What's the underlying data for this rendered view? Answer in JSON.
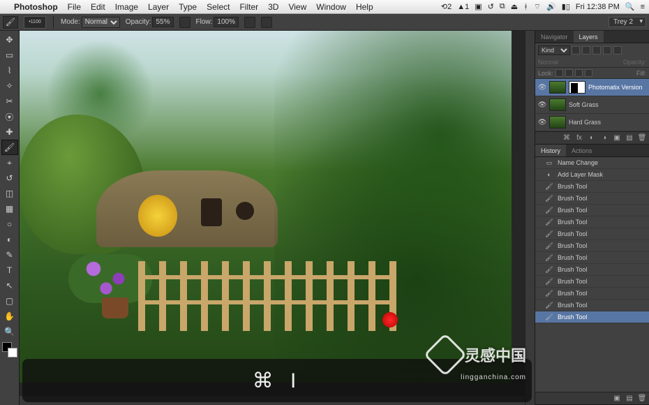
{
  "menubar": {
    "app": "Photoshop",
    "items": [
      "File",
      "Edit",
      "Image",
      "Layer",
      "Type",
      "Select",
      "Filter",
      "3D",
      "View",
      "Window",
      "Help"
    ],
    "clock": "Fri 12:38 PM"
  },
  "options": {
    "brush_size": "1100",
    "mode_label": "Mode:",
    "mode_value": "Normal",
    "opacity_label": "Opacity:",
    "opacity_value": "55%",
    "flow_label": "Flow:",
    "flow_value": "100%",
    "workspace": "Trey 2"
  },
  "tools": [
    "move",
    "marquee",
    "lasso",
    "wand",
    "crop",
    "eyedrop",
    "heal",
    "brush",
    "stamp",
    "history-brush",
    "eraser",
    "gradient",
    "blur",
    "dodge",
    "pen",
    "type",
    "path",
    "shape",
    "hand",
    "zoom"
  ],
  "layers_panel": {
    "tabs": [
      "Navigator",
      "Layers"
    ],
    "active_tab": "Layers",
    "kind_label": "Kind",
    "blend": "Normal",
    "opacity_label": "Opacity:",
    "lock_label": "Lock:",
    "fill_label": "Fill:",
    "layers": [
      {
        "name": "Photomatix Version",
        "selected": true,
        "mask": true
      },
      {
        "name": "Soft Grass",
        "selected": false,
        "mask": false
      },
      {
        "name": "Hard Grass",
        "selected": false,
        "mask": false
      }
    ]
  },
  "history_panel": {
    "tabs": [
      "History",
      "Actions"
    ],
    "active_tab": "History",
    "items": [
      {
        "label": "Name Change",
        "icon": "rename"
      },
      {
        "label": "Add Layer Mask",
        "icon": "mask"
      },
      {
        "label": "Brush Tool",
        "icon": "brush"
      },
      {
        "label": "Brush Tool",
        "icon": "brush"
      },
      {
        "label": "Brush Tool",
        "icon": "brush"
      },
      {
        "label": "Brush Tool",
        "icon": "brush"
      },
      {
        "label": "Brush Tool",
        "icon": "brush"
      },
      {
        "label": "Brush Tool",
        "icon": "brush"
      },
      {
        "label": "Brush Tool",
        "icon": "brush"
      },
      {
        "label": "Brush Tool",
        "icon": "brush"
      },
      {
        "label": "Brush Tool",
        "icon": "brush"
      },
      {
        "label": "Brush Tool",
        "icon": "brush"
      },
      {
        "label": "Brush Tool",
        "icon": "brush"
      },
      {
        "label": "Brush Tool",
        "icon": "brush",
        "selected": true
      }
    ]
  },
  "shortcut_overlay": "⌘ I",
  "watermark": {
    "main": "灵感中国",
    "sub": "lingganchina.com"
  }
}
